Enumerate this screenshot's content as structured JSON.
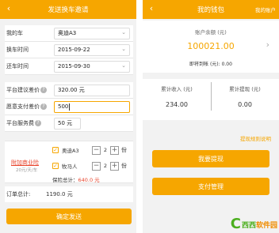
{
  "left_screen": {
    "title": "发送换车邀请",
    "back_icon": "‹",
    "rows": [
      {
        "label": "我的车",
        "value": "奥迪A3"
      },
      {
        "label": "换车时间",
        "value": "2015-09-22"
      },
      {
        "label": "还车时间",
        "value": "2015-09-30"
      },
      {
        "label": "平台建议差价",
        "value": "320.00 元"
      },
      {
        "label": "愿意支付差价",
        "value": "500"
      },
      {
        "label": "平台服务费",
        "value": "50 元"
      }
    ],
    "insurance": {
      "label": "附加商业险",
      "unit": "20元/天/车",
      "items": [
        {
          "name": "奥迪A3",
          "qty": "2",
          "unit": "份",
          "checked": true
        },
        {
          "name": "牧马人",
          "qty": "2",
          "unit": "份",
          "checked": true
        }
      ],
      "total_label": "保险总计：",
      "total_value": "640.0 元"
    },
    "order_total_label": "订单总计:",
    "order_total_value": "1190.0 元",
    "confirm_button": "确定发送"
  },
  "right_screen": {
    "title": "我的钱包",
    "back_icon": "‹",
    "right_link": "我的账户",
    "balance_label": "账户余额 (元)",
    "balance_value": "100021.00",
    "pending_text": "即将到帐 (元): 0.00",
    "stats": [
      {
        "label": "累计收入 (元)",
        "value": "234.00"
      },
      {
        "label": "累计提现 (元)",
        "value": "0.00"
      }
    ],
    "rule_link": "提现规则说明",
    "withdraw_button": "我要提现",
    "manage_button": "支付管理"
  },
  "watermark": {
    "text_green": "西西",
    "text_orange": "软件园"
  },
  "colors": {
    "accent": "#f6a600",
    "alert": "#e8442c",
    "watermark": "#4caf1f"
  },
  "icons": {
    "back": "chevron-left-icon",
    "dropdown": "chevron-down-icon",
    "help": "question-icon",
    "arrow": "chevron-right-icon",
    "plus": "plus-icon",
    "minus": "minus-icon"
  }
}
